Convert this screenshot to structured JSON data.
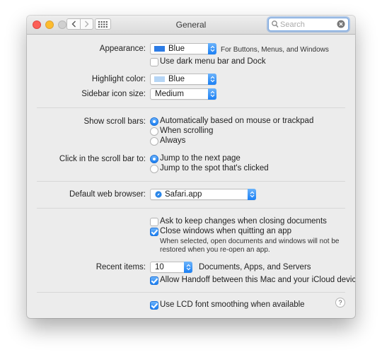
{
  "window": {
    "title": "General",
    "search": {
      "placeholder": "Search",
      "value": ""
    }
  },
  "appearance": {
    "label": "Appearance:",
    "value": "Blue",
    "note": "For Buttons, Menus, and Windows",
    "dark_menu_label": "Use dark menu bar and Dock",
    "dark_menu_checked": false
  },
  "highlight": {
    "label": "Highlight color:",
    "value": "Blue",
    "swatch_color": "#b5d5f5"
  },
  "sidebar": {
    "label": "Sidebar icon size:",
    "value": "Medium"
  },
  "scrollbars": {
    "label": "Show scroll bars:",
    "options": [
      {
        "label": "Automatically based on mouse or trackpad",
        "selected": true
      },
      {
        "label": "When scrolling",
        "selected": false
      },
      {
        "label": "Always",
        "selected": false
      }
    ]
  },
  "click_scroll": {
    "label": "Click in the scroll bar to:",
    "options": [
      {
        "label": "Jump to the next page",
        "selected": true
      },
      {
        "label": "Jump to the spot that's clicked",
        "selected": false
      }
    ]
  },
  "browser": {
    "label": "Default web browser:",
    "value": "Safari.app"
  },
  "documents": {
    "ask_label": "Ask to keep changes when closing documents",
    "ask_checked": false,
    "close_label": "Close windows when quitting an app",
    "close_checked": true,
    "hint_line1": "When selected, open documents and windows will not be",
    "hint_line2": "restored when you re-open an app."
  },
  "recent": {
    "label": "Recent items:",
    "value": "10",
    "suffix": "Documents, Apps, and Servers"
  },
  "handoff": {
    "label": "Allow Handoff between this Mac and your iCloud devices",
    "checked": true
  },
  "lcd": {
    "label": "Use LCD font smoothing when available",
    "checked": true
  },
  "help": {
    "label": "?"
  },
  "colors": {
    "accent": "#1a7ff4",
    "appearance_swatch": "#2c7be5"
  }
}
